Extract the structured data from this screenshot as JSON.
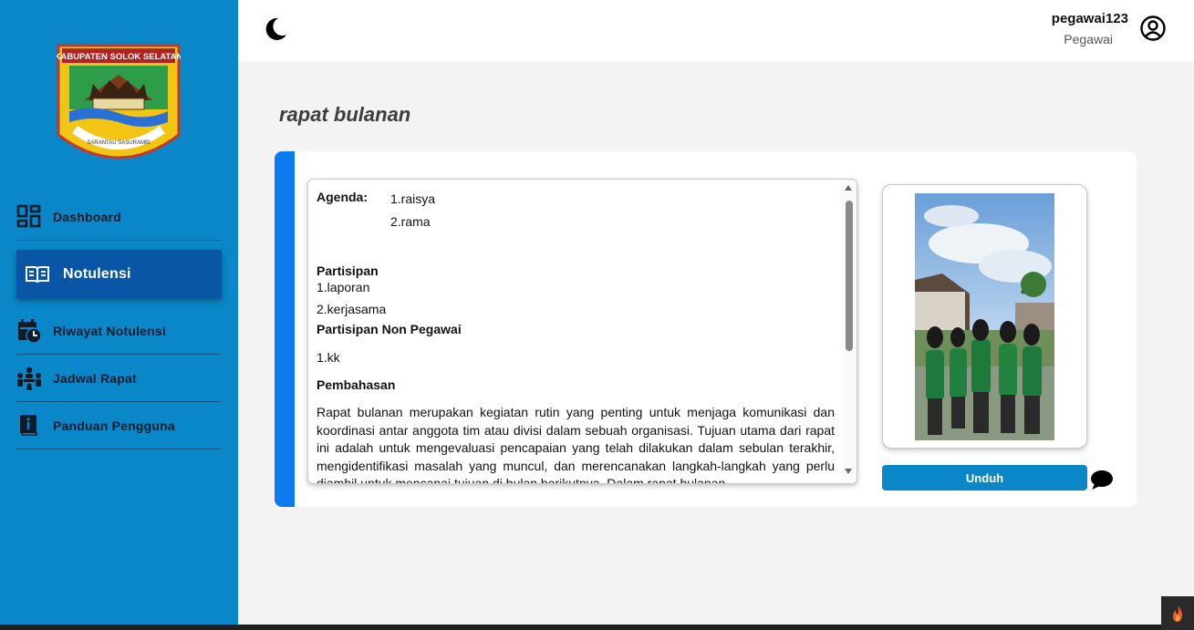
{
  "sidebar": {
    "logo_text_top": "KABUPATEN SOLOK SELATAN",
    "logo_text_ribbon": "SARANTAU SASURAMBI",
    "items": [
      {
        "label": "Dashboard",
        "icon": "dashboard-grid-icon"
      },
      {
        "label": "Notulensi",
        "icon": "open-book-icon",
        "active": true
      },
      {
        "label": "Riwayat Notulensi",
        "icon": "calendar-clock-icon"
      },
      {
        "label": "Jadwal Rapat",
        "icon": "meeting-people-icon"
      },
      {
        "label": "Panduan Pengguna",
        "icon": "manual-book-icon"
      }
    ]
  },
  "header": {
    "theme_icon": "moon-icon",
    "user_name": "pegawai123",
    "user_role": "Pegawai",
    "user_icon": "user-circle-icon"
  },
  "page": {
    "title": "rapat bulanan"
  },
  "notulen": {
    "agenda_label": "Agenda:",
    "agenda_items": [
      "1.raisya",
      "2.rama"
    ],
    "partisipan_label": "Partisipan",
    "partisipan_items": [
      "1.laporan",
      "2.kerjasama"
    ],
    "non_pegawai_label": "Partisipan Non Pegawai",
    "non_pegawai_items": [
      "1.kk"
    ],
    "pembahasan_label": "Pembahasan",
    "pembahasan_text": "Rapat bulanan merupakan kegiatan rutin yang penting untuk menjaga komunikasi dan koordinasi antar anggota tim atau divisi dalam sebuah organisasi. Tujuan utama dari rapat ini adalah untuk mengevaluasi pencapaian yang telah dilakukan dalam sebulan terakhir, mengidentifikasi masalah yang muncul, dan merencanakan langkah-langkah yang perlu diambil untuk mencapai tujuan di bulan berikutnya. Dalam rapat bulanan"
  },
  "actions": {
    "download_label": "Unduh",
    "chat_icon": "chat-bubble-icon"
  },
  "colors": {
    "sidebar": "#0a87c8",
    "active_item": "#0a56a6",
    "accent": "#0d7bf0",
    "button": "#0a87c8"
  }
}
